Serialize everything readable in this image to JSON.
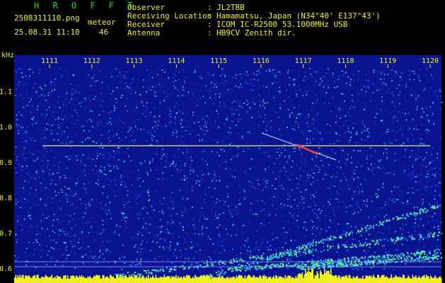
{
  "header": {
    "app_title": "H R O F F T",
    "filename": "2508311110.png",
    "timestamp": "25.08.31 11:10",
    "detection_label": "meteor",
    "detection_count": "46",
    "fields": [
      {
        "label": "Observer",
        "value": "JL2TBB"
      },
      {
        "label": "Receiving Location",
        "value": "Hamamatsu, Japan (N34°40' E137°43')"
      },
      {
        "label": "Receiver",
        "value": "ICOM IC-R2500 53.1000MHz USB"
      },
      {
        "label": "Antenna",
        "value": "HB9CV Zenith dir."
      }
    ]
  },
  "axis": {
    "y_unit": "kHz",
    "y_ticks": [
      "1.1",
      "1.0",
      "0.9",
      "0.8",
      "0.7",
      "0.6"
    ],
    "x_ticks": [
      "1111",
      "1112",
      "1113",
      "1114",
      "1115",
      "1116",
      "1117",
      "1118",
      "1119",
      "1120"
    ]
  },
  "colors": {
    "background": "#000000",
    "plot_bg": "#0a1490",
    "text": "#f2f200",
    "title": "#19e019",
    "carrier": "#e8f080",
    "meteor": "#ff4040"
  }
}
